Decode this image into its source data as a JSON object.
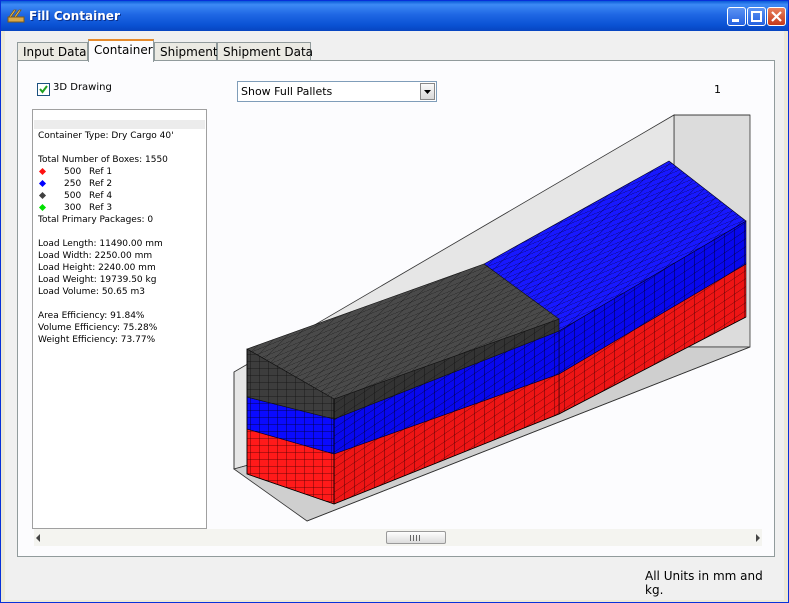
{
  "window": {
    "title": "Fill Container"
  },
  "tabs": [
    {
      "label": "Input Data"
    },
    {
      "label": "Container"
    },
    {
      "label": "Shipment"
    },
    {
      "label": "Shipment Data"
    }
  ],
  "active_tab": "Container",
  "controls": {
    "drawing_3d": {
      "label": "3D Drawing",
      "checked": true
    },
    "view_select": {
      "value": "Show Full Pallets"
    },
    "page_number": "1"
  },
  "info": {
    "container_type": "Container Type: Dry Cargo 40'",
    "total_boxes": "Total Number of Boxes: 1550",
    "legend": [
      {
        "count": "500",
        "ref": "Ref 1",
        "color": "#ff1010"
      },
      {
        "count": "250",
        "ref": "Ref 2",
        "color": "#0000ff"
      },
      {
        "count": "500",
        "ref": "Ref 4",
        "color": "#404040"
      },
      {
        "count": "300",
        "ref": "Ref 3",
        "color": "#00e000"
      }
    ],
    "total_primary": "Total Primary Packages: 0",
    "load_length": "Load Length: 11490.00 mm",
    "load_width": "Load Width: 2250.00 mm",
    "load_height": "Load Height: 2240.00 mm",
    "load_weight": "Load Weight: 19739.50 kg",
    "load_volume": "Load Volume: 50.65 m3",
    "area_eff": "Area Efficiency: 91.84%",
    "volume_eff": "Volume Efficiency: 75.28%",
    "weight_eff": "Weight Efficiency: 73.77%"
  },
  "footer": {
    "units": "All Units in mm and kg."
  },
  "colors": {
    "red": "#ff1a1a",
    "blue": "#0a0aff",
    "dark": "#3d3d3d",
    "container_wall": "#d0d0d0"
  }
}
